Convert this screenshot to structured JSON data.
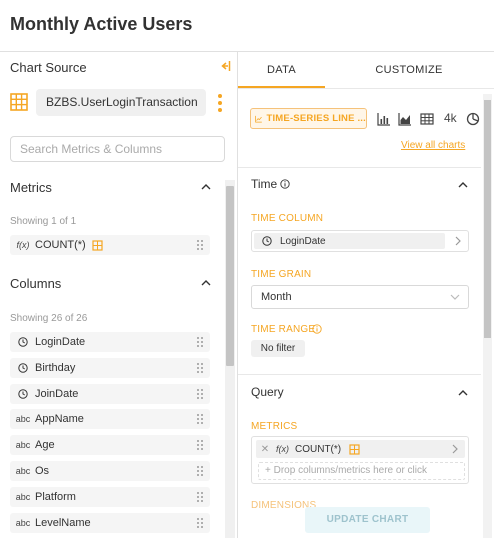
{
  "page_title": "Monthly Active Users",
  "left": {
    "chart_source_label": "Chart Source",
    "datasource": "BZBS.UserLoginTransaction",
    "search_placeholder": "Search Metrics & Columns",
    "metrics": {
      "title": "Metrics",
      "showing": "Showing 1 of 1",
      "items": [
        {
          "icon": "f(x)",
          "label": "COUNT(*)"
        }
      ]
    },
    "columns": {
      "title": "Columns",
      "showing": "Showing 26 of 26",
      "items": [
        {
          "icon": "clock",
          "label": "LoginDate"
        },
        {
          "icon": "clock",
          "label": "Birthday"
        },
        {
          "icon": "clock",
          "label": "JoinDate"
        },
        {
          "icon": "abc",
          "label": "AppName"
        },
        {
          "icon": "abc",
          "label": "Age"
        },
        {
          "icon": "abc",
          "label": "Os"
        },
        {
          "icon": "abc",
          "label": "Platform"
        },
        {
          "icon": "abc",
          "label": "LevelName"
        }
      ]
    }
  },
  "right": {
    "tabs": [
      "DATA",
      "CUSTOMIZE"
    ],
    "viz_type": "TIME-SERIES LINE ...",
    "k4": "4k",
    "view_all": "View all charts",
    "time": {
      "title": "Time",
      "time_column_label": "TIME COLUMN",
      "time_column_value": "LoginDate",
      "time_grain_label": "TIME GRAIN",
      "time_grain_value": "Month",
      "time_range_label": "TIME RANGE",
      "time_range_value": "No filter"
    },
    "query": {
      "title": "Query",
      "metrics_label": "METRICS",
      "metric_fx": "f(x)",
      "metric_value": "COUNT(*)",
      "drop_hint": "+ Drop columns/metrics here or click",
      "dimensions_label": "DIMENSIONS"
    },
    "update_button": "UPDATE CHART"
  },
  "colors": {
    "accent": "#f5a623",
    "update_bg": "#e9f6f9"
  }
}
